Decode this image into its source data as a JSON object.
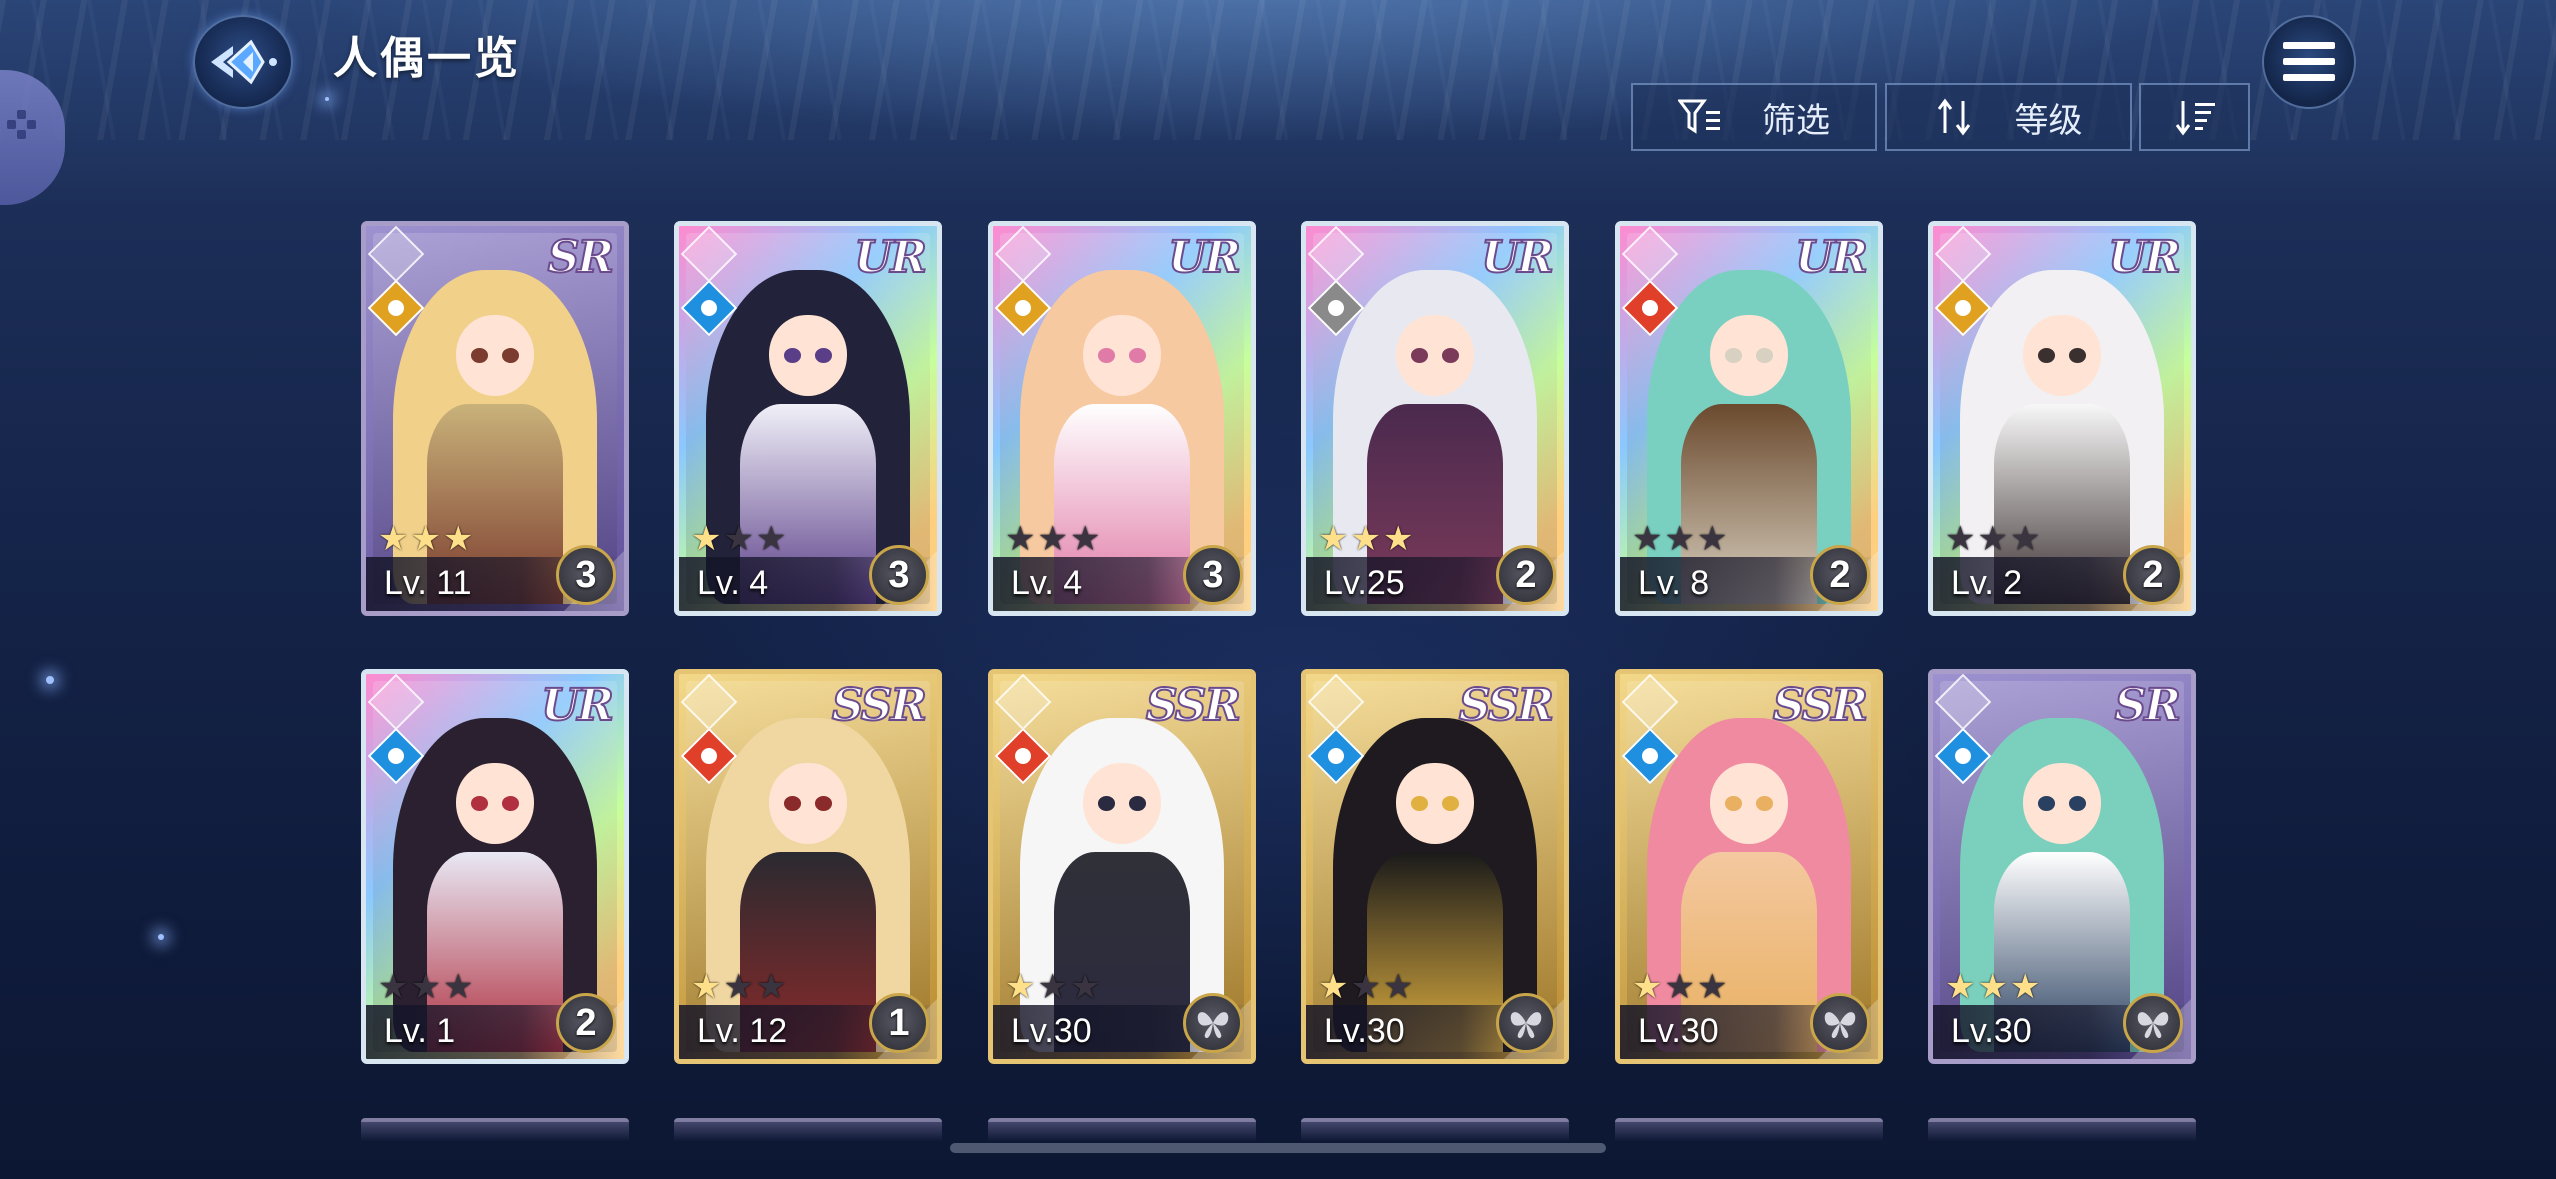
{
  "header": {
    "title": "人偶一览",
    "back_icon": "back-arrow-icon",
    "menu_icon": "hamburger-menu-icon"
  },
  "toolbar": {
    "filter_label": "筛选",
    "filter_icon": "filter-icon",
    "sort_label": "等级",
    "sort_icon": "sort-icon",
    "order_icon": "sort-order-icon"
  },
  "cards": [
    {
      "rarity": "SR",
      "level": "Lv. 11",
      "stars": 3,
      "count": "3",
      "element": "light",
      "frame": "sr"
    },
    {
      "rarity": "UR",
      "level": "Lv. 4",
      "stars": 1,
      "count": "3",
      "element": "water",
      "frame": "ur"
    },
    {
      "rarity": "UR",
      "level": "Lv. 4",
      "stars": 0,
      "count": "3",
      "element": "light",
      "frame": "ur"
    },
    {
      "rarity": "UR",
      "level": "Lv.25",
      "stars": 3,
      "count": "2",
      "element": "dark",
      "frame": "ur"
    },
    {
      "rarity": "UR",
      "level": "Lv. 8",
      "stars": 0,
      "count": "2",
      "element": "fire",
      "frame": "ur"
    },
    {
      "rarity": "UR",
      "level": "Lv. 2",
      "stars": 0,
      "count": "2",
      "element": "light",
      "frame": "ur"
    },
    {
      "rarity": "UR",
      "level": "Lv. 1",
      "stars": 0,
      "count": "2",
      "element": "water",
      "frame": "ur"
    },
    {
      "rarity": "SSR",
      "level": "Lv. 12",
      "stars": 1,
      "count": "1",
      "element": "fire",
      "frame": "ssr"
    },
    {
      "rarity": "SSR",
      "level": "Lv.30",
      "stars": 1,
      "count": "",
      "element": "fire",
      "frame": "ssr"
    },
    {
      "rarity": "SSR",
      "level": "Lv.30",
      "stars": 1,
      "count": "",
      "element": "water",
      "frame": "ssr"
    },
    {
      "rarity": "SSR",
      "level": "Lv.30",
      "stars": 1,
      "count": "",
      "element": "water",
      "frame": "ssr"
    },
    {
      "rarity": "SR",
      "level": "Lv.30",
      "stars": 3,
      "count": "",
      "element": "water",
      "frame": "sr"
    }
  ],
  "colors": {
    "element_light": "#e0a020",
    "element_water": "#1f8fe0",
    "element_fire": "#e0402a",
    "element_dark": "#8a8a8a"
  }
}
